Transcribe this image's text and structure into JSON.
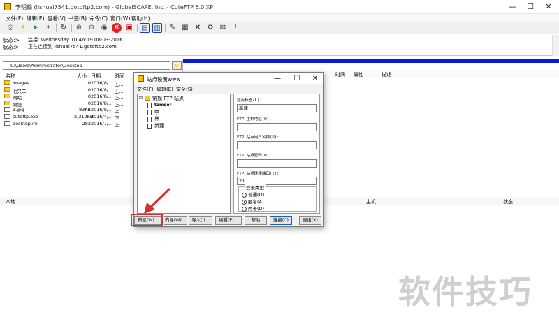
{
  "window": {
    "title": "李明翰 (lishuai7541.gotoftp2.com) - GlobalSCAPE, Inc. - CuteFTP 5.0 XP",
    "minimize": "—",
    "maximize": "☐",
    "close": "✕"
  },
  "menu": [
    "文件(F)",
    "编辑(E)",
    "查看(V)",
    "书签(B)",
    "命令(C)",
    "窗口(W)",
    "帮助(H)"
  ],
  "log": {
    "label1": "状态:>",
    "value1": "连接: Wednesday 10:46:19 08-03-2016",
    "label2": "状态:>",
    "value2": "正在连接到 lishuai7541.gotoftp2.com"
  },
  "local": {
    "path": "C:\\Users\\Administrator\\Desktop",
    "headers": {
      "name": "名称",
      "size": "大小",
      "date": "日期",
      "time": "时间"
    },
    "files": [
      {
        "name": "images",
        "size": "0",
        "date": "2016/8/...",
        "time": "上...",
        "kind": "folder"
      },
      {
        "name": "七只羊",
        "size": "0",
        "date": "2016/8/...",
        "time": "上...",
        "kind": "folder"
      },
      {
        "name": "网站",
        "size": "0",
        "date": "2016/8/...",
        "time": "上...",
        "kind": "folder"
      },
      {
        "name": "眼镜",
        "size": "0",
        "date": "2016/8/...",
        "time": "上...",
        "kind": "folder"
      },
      {
        "name": "1.jpg",
        "size": "83KB",
        "date": "2016/8/...",
        "time": "上...",
        "kind": "file"
      },
      {
        "name": "cuteftp.exe",
        "size": "2,312KB",
        "date": "2016/4/...",
        "time": "下...",
        "kind": "file"
      },
      {
        "name": "desktop.ini",
        "size": "282",
        "date": "2016/7/...",
        "time": "上...",
        "kind": "file"
      }
    ]
  },
  "remote": {
    "headers": {
      "time": "时间",
      "attr": "属性",
      "desc": "描述"
    }
  },
  "queue": {
    "headers": {
      "local": "本地",
      "host": "主机",
      "status": "状态"
    }
  },
  "dialog": {
    "title": "站点设置www",
    "menu": [
      "文件(F)",
      "编辑(E)",
      "安全(S)"
    ],
    "tree": {
      "root": "常规 FTP 站点",
      "children": [
        "tomoer",
        "李",
        "林",
        "新建"
      ]
    },
    "form": {
      "site_label": "站点标签(L):",
      "site_label_value": "新建",
      "host_label": "FTP 主机地址(H):",
      "host_value": "",
      "user_label": "FTP 站点用户名称(U):",
      "user_value": "",
      "pass_label": "FTP 站点密码(W):",
      "pass_value": "",
      "port_label": "FTP 站点连接端口(T):",
      "port_value": "21",
      "login_group": "登录类型",
      "login_options": [
        "普通(O)",
        "匿名(A)",
        "两者(D)"
      ],
      "login_selected": 1
    },
    "buttons": {
      "new": "新建(W)...",
      "wizard": "向导(W)...",
      "import": "导入(I)...",
      "edit": "编辑(E)...",
      "help": "帮助",
      "connect": "连接(C)",
      "exit": "退出(X)"
    }
  },
  "watermark": "软件技巧",
  "colors": {
    "accent": "#0a1bd6",
    "highlight": "#d63030",
    "folder": "#f5c842"
  }
}
